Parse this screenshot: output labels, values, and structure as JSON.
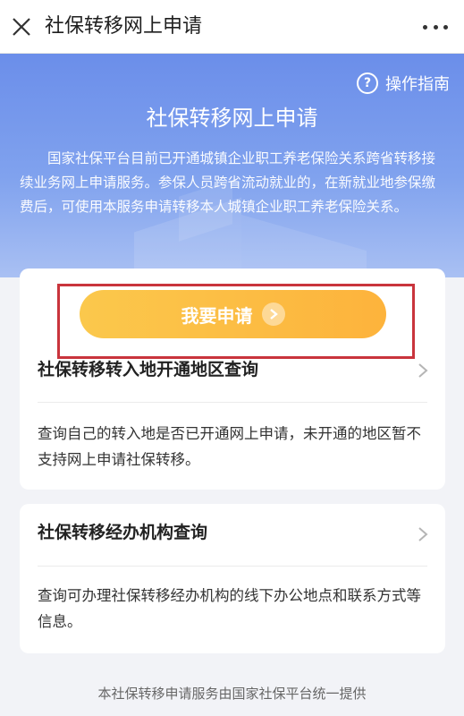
{
  "topbar": {
    "title": "社保转移网上申请",
    "close_icon": "close-icon",
    "more_icon": "more-icon"
  },
  "hero": {
    "guide_label": "操作指南",
    "title": "社保转移网上申请",
    "description": "国家社保平台目前已开通城镇企业职工养老保险关系跨省转移接续业务网上申请服务。参保人员跨省流动就业的，在新就业地参保缴费后，可使用本服务申请转移本人城镇企业职工养老保险关系。"
  },
  "apply": {
    "button_label": "我要申请"
  },
  "items": [
    {
      "title": "社保转移转入地开通地区查询",
      "description": "查询自己的转入地是否已开通网上申请，未开通的地区暂不支持网上申请社保转移。"
    },
    {
      "title": "社保转移经办机构查询",
      "description": "查询可办理社保转移经办机构的线下办公地点和联系方式等信息。"
    }
  ],
  "footer": {
    "text": "本社保转移申请服务由国家社保平台统一提供"
  },
  "colors": {
    "hero_gradient_top": "#6b8eea",
    "button_gradient_start": "#fbc84c",
    "highlight_border": "#c9343c"
  }
}
